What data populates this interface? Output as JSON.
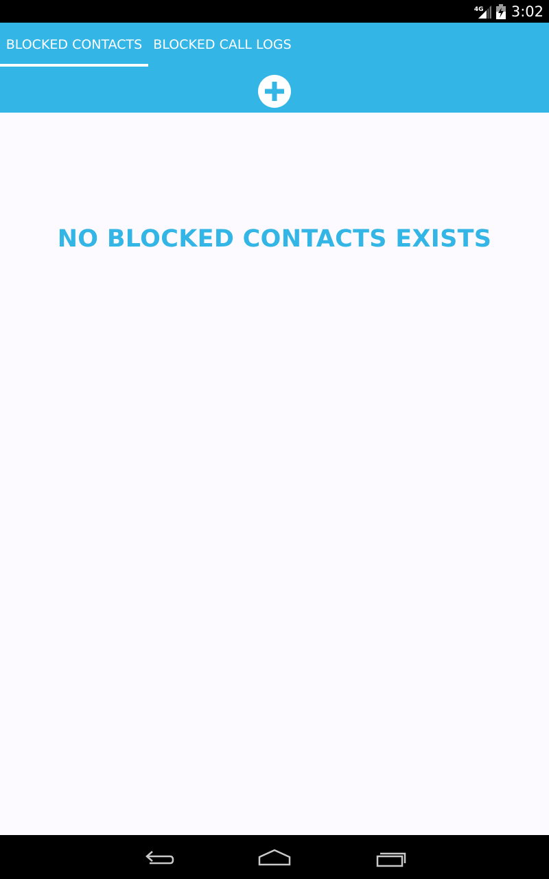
{
  "status_bar": {
    "network_type": "4G",
    "time": "3:02",
    "icons": [
      "signal-icon",
      "battery-charging-icon"
    ]
  },
  "tabs": [
    {
      "label": "BLOCKED CONTACTS",
      "selected": true
    },
    {
      "label": "BLOCKED CALL LOGS",
      "selected": false
    }
  ],
  "toolbar": {
    "add_icon": "add-circle-icon"
  },
  "content": {
    "empty_message": "NO BLOCKED CONTACTS EXISTS"
  },
  "nav_bar": {
    "buttons": [
      "back-icon",
      "home-icon",
      "recent-apps-icon"
    ]
  },
  "colors": {
    "accent": "#33b5e5",
    "background": "#fdfaff",
    "system_bar": "#000000",
    "tab_text": "#ffffff"
  }
}
